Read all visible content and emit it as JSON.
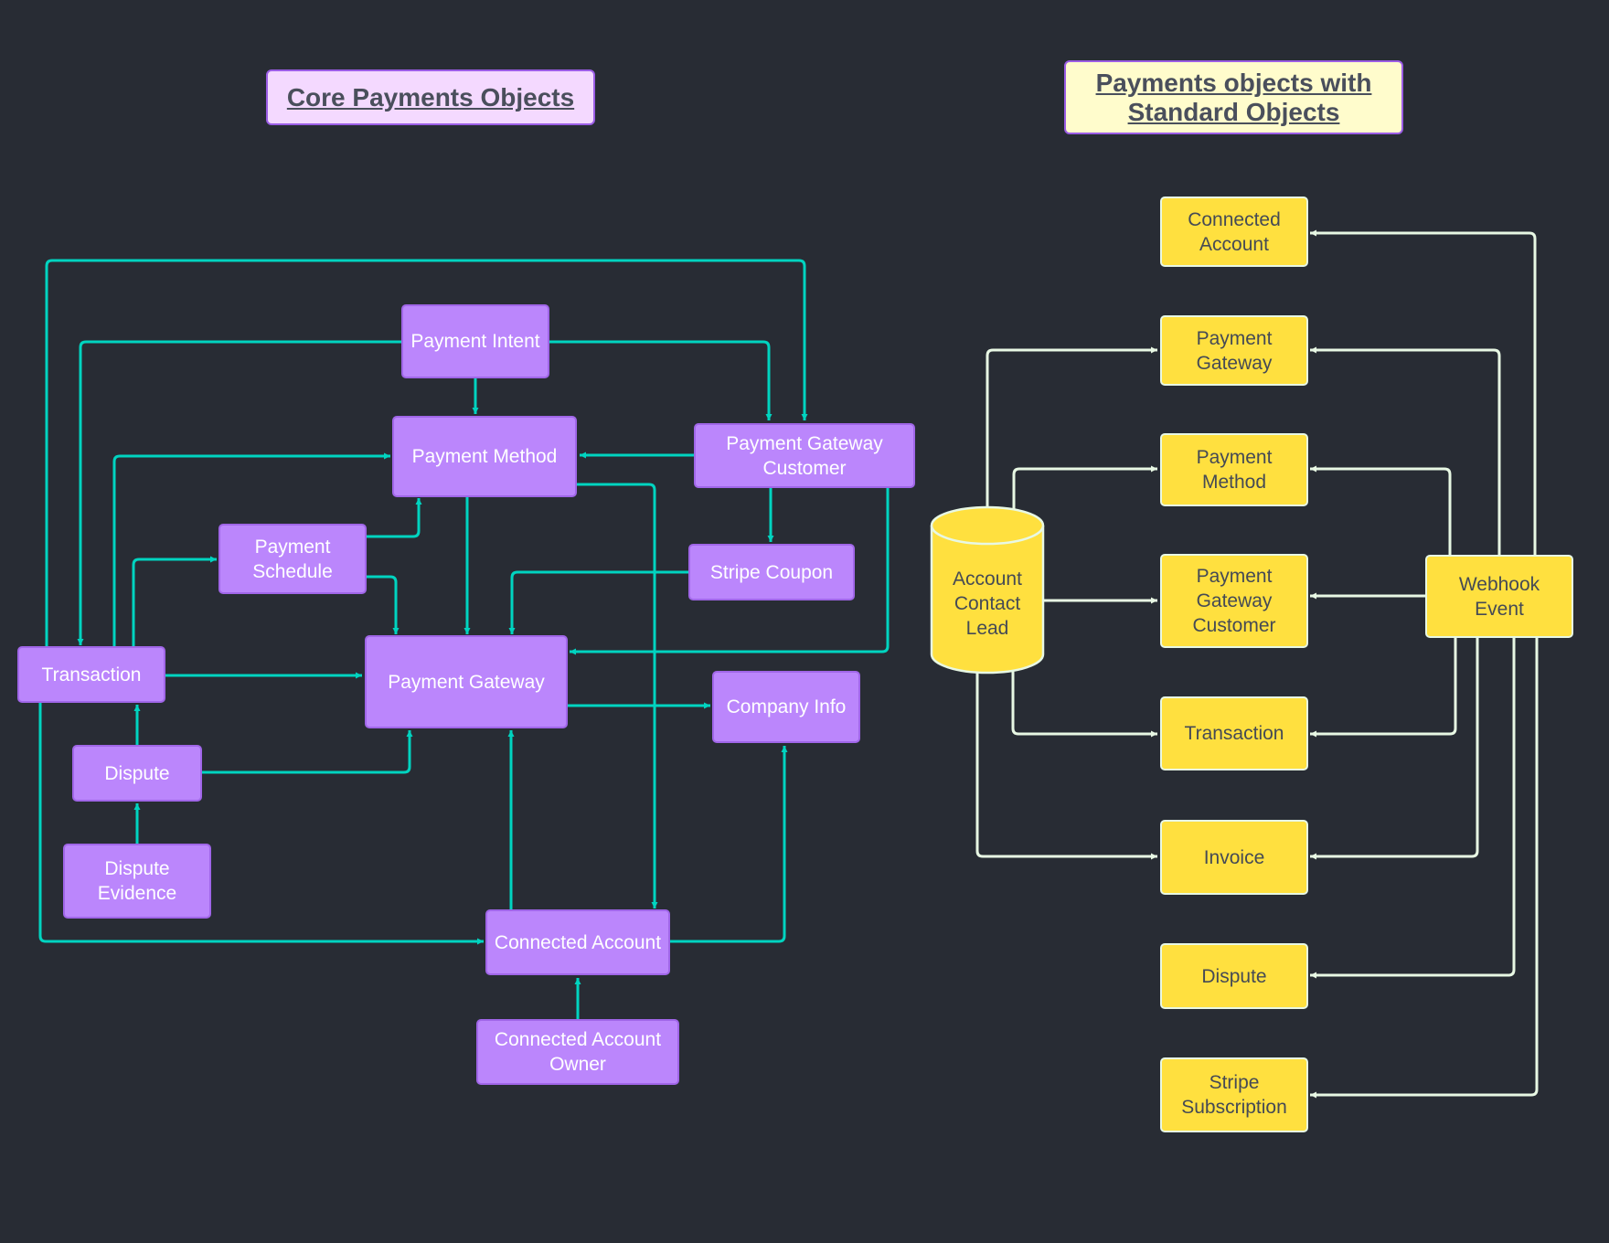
{
  "titles": {
    "left": "Core Payments Objects",
    "right": "Payments objects with Standard Objects"
  },
  "colors": {
    "background": "#282c34",
    "core_node": "#bb86fc",
    "core_edge": "#00d4c0",
    "standard_node": "#ffe03f",
    "standard_edge": "#e8f8e4",
    "left_title_bg": "#f4d9ff",
    "right_title_bg": "#fffccc"
  },
  "core": {
    "nodes": [
      {
        "id": "payment_intent",
        "label": "Payment Intent"
      },
      {
        "id": "payment_method",
        "label": "Payment Method"
      },
      {
        "id": "pg_customer",
        "label": "Payment Gateway Customer"
      },
      {
        "id": "payment_schedule",
        "label": "Payment Schedule"
      },
      {
        "id": "stripe_coupon",
        "label": "Stripe Coupon"
      },
      {
        "id": "transaction",
        "label": "Transaction"
      },
      {
        "id": "payment_gateway",
        "label": "Payment Gateway"
      },
      {
        "id": "company_info",
        "label": "Company Info"
      },
      {
        "id": "dispute",
        "label": "Dispute"
      },
      {
        "id": "dispute_evidence",
        "label": "Dispute Evidence"
      },
      {
        "id": "connected_account",
        "label": "Connected Account"
      },
      {
        "id": "connected_account_owner",
        "label": "Connected Account Owner"
      }
    ],
    "edges": [
      {
        "from": "payment_intent",
        "to": "payment_method"
      },
      {
        "from": "payment_intent",
        "to": "pg_customer"
      },
      {
        "from": "payment_intent",
        "to": "transaction"
      },
      {
        "from": "transaction",
        "to": "pg_customer"
      },
      {
        "from": "transaction",
        "to": "payment_method"
      },
      {
        "from": "transaction",
        "to": "payment_schedule"
      },
      {
        "from": "transaction",
        "to": "payment_gateway"
      },
      {
        "from": "transaction",
        "to": "connected_account"
      },
      {
        "from": "pg_customer",
        "to": "payment_method"
      },
      {
        "from": "pg_customer",
        "to": "stripe_coupon"
      },
      {
        "from": "pg_customer",
        "to": "payment_gateway"
      },
      {
        "from": "payment_schedule",
        "to": "payment_method"
      },
      {
        "from": "payment_schedule",
        "to": "payment_gateway"
      },
      {
        "from": "payment_method",
        "to": "payment_gateway"
      },
      {
        "from": "payment_method",
        "to": "connected_account"
      },
      {
        "from": "stripe_coupon",
        "to": "payment_gateway"
      },
      {
        "from": "payment_gateway",
        "to": "company_info"
      },
      {
        "from": "dispute",
        "to": "transaction"
      },
      {
        "from": "dispute",
        "to": "payment_gateway"
      },
      {
        "from": "dispute_evidence",
        "to": "dispute"
      },
      {
        "from": "connected_account",
        "to": "payment_gateway"
      },
      {
        "from": "connected_account",
        "to": "company_info"
      },
      {
        "from": "connected_account_owner",
        "to": "connected_account"
      }
    ]
  },
  "standard": {
    "source": {
      "id": "acl",
      "label": "Account Contact Lead",
      "shape": "database-cylinder"
    },
    "event": {
      "id": "webhook",
      "label": "Webhook Event"
    },
    "nodes": [
      {
        "id": "s_connected_account",
        "label": "Connected Account"
      },
      {
        "id": "s_payment_gateway",
        "label": "Payment Gateway"
      },
      {
        "id": "s_payment_method",
        "label": "Payment Method"
      },
      {
        "id": "s_pg_customer",
        "label": "Payment Gateway Customer"
      },
      {
        "id": "s_transaction",
        "label": "Transaction"
      },
      {
        "id": "s_invoice",
        "label": "Invoice"
      },
      {
        "id": "s_dispute",
        "label": "Dispute"
      },
      {
        "id": "s_stripe_subscription",
        "label": "Stripe Subscription"
      }
    ],
    "edges": [
      {
        "from": "acl",
        "to": "s_payment_gateway"
      },
      {
        "from": "acl",
        "to": "s_payment_method"
      },
      {
        "from": "acl",
        "to": "s_pg_customer"
      },
      {
        "from": "acl",
        "to": "s_transaction"
      },
      {
        "from": "acl",
        "to": "s_invoice"
      },
      {
        "from": "webhook",
        "to": "s_connected_account"
      },
      {
        "from": "webhook",
        "to": "s_payment_gateway"
      },
      {
        "from": "webhook",
        "to": "s_payment_method"
      },
      {
        "from": "webhook",
        "to": "s_pg_customer"
      },
      {
        "from": "webhook",
        "to": "s_transaction"
      },
      {
        "from": "webhook",
        "to": "s_invoice"
      },
      {
        "from": "webhook",
        "to": "s_dispute"
      },
      {
        "from": "webhook",
        "to": "s_stripe_subscription"
      }
    ]
  }
}
